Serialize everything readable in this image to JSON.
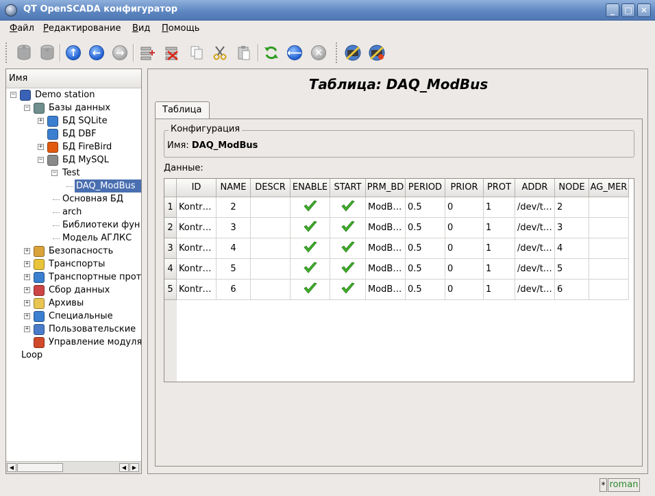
{
  "window": {
    "title": "QT OpenSCADA конфигуратор",
    "icon": "openscada-app-icon",
    "buttons": [
      "_",
      "□",
      "✕"
    ]
  },
  "menu": [
    {
      "label": "Файл",
      "mnemonic": "Ф",
      "rest": "айл"
    },
    {
      "label": "Редактирование",
      "mnemonic": "Р",
      "rest": "едактирование"
    },
    {
      "label": "Вид",
      "mnemonic": "В",
      "rest": "ид"
    },
    {
      "label": "Помощь",
      "mnemonic": "П",
      "rest": "омощь"
    }
  ],
  "toolbar": {
    "buttons": [
      "db-load-icon",
      "db-save-icon",
      "up-icon",
      "back-icon",
      "forward-icon",
      "add-item-icon",
      "delete-item-icon",
      "copy-icon",
      "cut-icon",
      "paste-icon",
      "refresh-icon",
      "start-icon",
      "stop-icon",
      "connect-station-icon",
      "disconnect-station-icon"
    ]
  },
  "tree": {
    "header": "Имя",
    "items": [
      {
        "label": "Demo station",
        "level": 0,
        "expander": "-",
        "icon": "station-icon"
      },
      {
        "label": "Базы данных",
        "level": 1,
        "expander": "-",
        "icon": "database-icon"
      },
      {
        "label": "БД SQLite",
        "level": 2,
        "expander": "+",
        "icon": "sqlite-icon"
      },
      {
        "label": "БД DBF",
        "level": 2,
        "expander": "",
        "icon": "dbf-icon"
      },
      {
        "label": "БД FireBird",
        "level": 2,
        "expander": "+",
        "icon": "firebird-icon"
      },
      {
        "label": "БД MySQL",
        "level": 2,
        "expander": "-",
        "icon": "mysql-icon"
      },
      {
        "label": "Test",
        "level": 3,
        "expander": "-",
        "icon": ""
      },
      {
        "label": "DAQ_ModBus",
        "level": 4,
        "expander": "",
        "icon": "",
        "selected": true
      },
      {
        "label": "Основная БД",
        "level": 3,
        "expander": "",
        "icon": ""
      },
      {
        "label": "arch",
        "level": 3,
        "expander": "",
        "icon": ""
      },
      {
        "label": "Библиотеки фун",
        "level": 3,
        "expander": "",
        "icon": ""
      },
      {
        "label": "Модель АГЛКС",
        "level": 3,
        "expander": "",
        "icon": ""
      },
      {
        "label": "Безопасность",
        "level": 1,
        "expander": "+",
        "icon": "security-icon"
      },
      {
        "label": "Транспорты",
        "level": 1,
        "expander": "+",
        "icon": "transport-icon"
      },
      {
        "label": "Транспортные прот",
        "level": 1,
        "expander": "+",
        "icon": "transport-protocol-icon"
      },
      {
        "label": "Сбор данных",
        "level": 1,
        "expander": "+",
        "icon": "daq-icon"
      },
      {
        "label": "Архивы",
        "level": 1,
        "expander": "+",
        "icon": "archive-icon"
      },
      {
        "label": "Специальные",
        "level": 1,
        "expander": "+",
        "icon": "special-icon"
      },
      {
        "label": "Пользовательские",
        "level": 1,
        "expander": "+",
        "icon": "user-interface-icon"
      },
      {
        "label": "Управление модуля",
        "level": 1,
        "expander": "",
        "icon": "module-manage-icon"
      },
      {
        "label": "Loop",
        "level": 0,
        "expander": "",
        "icon": ""
      }
    ]
  },
  "main": {
    "title": "Таблица: DAQ_ModBus",
    "tab": "Таблица",
    "config_group": "Конфигурация",
    "name_label": "Имя:",
    "name_value": "DAQ_ModBus",
    "data_label": "Данные:",
    "table": {
      "columns": [
        "ID",
        "NAME",
        "DESCR",
        "ENABLE",
        "START",
        "PRM_BD",
        "PERIOD",
        "PRIOR",
        "PROT",
        "ADDR",
        "NODE",
        "AG_MER"
      ],
      "rows": [
        {
          "num": "1",
          "cells": [
            "Kontr…",
            "2",
            "",
            true,
            true,
            "ModB…",
            "0.5",
            "0",
            "1",
            "/dev/t…",
            "2",
            ""
          ]
        },
        {
          "num": "2",
          "cells": [
            "Kontr…",
            "3",
            "",
            true,
            true,
            "ModB…",
            "0.5",
            "0",
            "1",
            "/dev/t…",
            "3",
            ""
          ]
        },
        {
          "num": "3",
          "cells": [
            "Kontr…",
            "4",
            "",
            true,
            true,
            "ModB…",
            "0.5",
            "0",
            "1",
            "/dev/t…",
            "4",
            ""
          ]
        },
        {
          "num": "4",
          "cells": [
            "Kontr…",
            "5",
            "",
            true,
            true,
            "ModB…",
            "0.5",
            "0",
            "1",
            "/dev/t…",
            "5",
            ""
          ]
        },
        {
          "num": "5",
          "cells": [
            "Kontr…",
            "6",
            "",
            true,
            true,
            "ModB…",
            "0.5",
            "0",
            "1",
            "/dev/t…",
            "6",
            ""
          ]
        }
      ]
    }
  },
  "status": {
    "modified": "*",
    "user": "roman"
  },
  "colors": {
    "title_bar": "#5f88c2",
    "selection": "#4a6fb1",
    "user_text": "#2a8a2a",
    "check": "#3fae2a"
  }
}
